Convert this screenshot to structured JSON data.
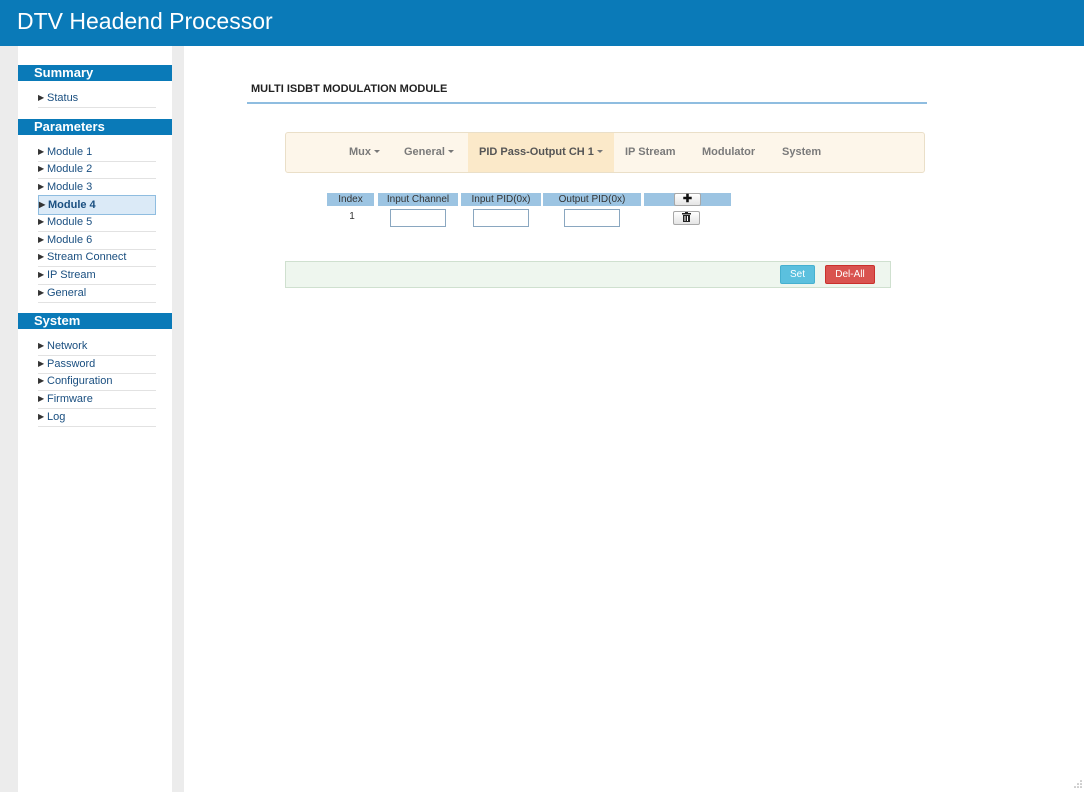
{
  "app": {
    "title": "DTV Headend Processor"
  },
  "sidebar": {
    "sections": [
      {
        "title": "Summary",
        "items": [
          "Status"
        ]
      },
      {
        "title": "Parameters",
        "items": [
          "Module 1",
          "Module 2",
          "Module 3",
          "Module 4",
          "Module 5",
          "Module 6",
          "Stream Connect",
          "IP Stream",
          "General"
        ],
        "active": "Module 4"
      },
      {
        "title": "System",
        "items": [
          "Network",
          "Password",
          "Configuration",
          "Firmware",
          "Log"
        ]
      }
    ]
  },
  "main": {
    "title": "MULTI ISDBT MODULATION MODULE",
    "tabs": [
      {
        "label": "Mux",
        "dropdown": true
      },
      {
        "label": "General",
        "dropdown": true
      },
      {
        "label": "PID Pass-Output CH 1",
        "dropdown": true,
        "active": true
      },
      {
        "label": "IP Stream",
        "dropdown": false
      },
      {
        "label": "Modulator",
        "dropdown": false
      },
      {
        "label": "System",
        "dropdown": false
      }
    ],
    "table": {
      "headers": [
        "Index",
        "Input Channel",
        "Input PID(0x)",
        "Output PID(0x)"
      ],
      "add_icon": "plus-icon",
      "rows": [
        {
          "index": "1",
          "input_channel": "",
          "input_pid": "",
          "output_pid": "",
          "delete_icon": "trash-icon"
        }
      ]
    },
    "actions": {
      "set_label": "Set",
      "delall_label": "Del-All"
    }
  },
  "colors": {
    "brand": "#0a7ab8",
    "tab_bg": "#fdf6ea",
    "tab_active": "#fbe9c9",
    "header_cell": "#9cc4e2",
    "set": "#5bc0de",
    "delall": "#d9534f"
  }
}
